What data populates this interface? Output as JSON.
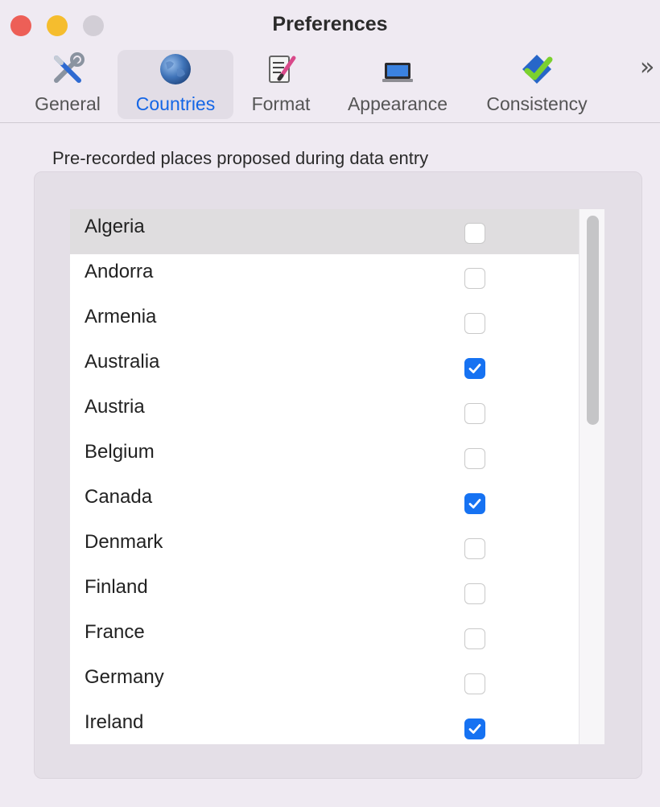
{
  "window": {
    "title": "Preferences"
  },
  "toolbar": {
    "tabs": [
      {
        "label": "General",
        "icon": "wrench-screwdriver-icon",
        "selected": false
      },
      {
        "label": "Countries",
        "icon": "globe-icon",
        "selected": true
      },
      {
        "label": "Format",
        "icon": "notepad-pencil-icon",
        "selected": false
      },
      {
        "label": "Appearance",
        "icon": "laptop-icon",
        "selected": false
      },
      {
        "label": "Consistency",
        "icon": "checkmark-diamond-icon",
        "selected": false
      }
    ],
    "overflow_label": "»"
  },
  "countries": {
    "caption": "Pre-recorded places proposed during data entry",
    "items": [
      {
        "name": "Algeria",
        "checked": false
      },
      {
        "name": "Andorra",
        "checked": false
      },
      {
        "name": "Armenia",
        "checked": false
      },
      {
        "name": "Australia",
        "checked": true
      },
      {
        "name": "Austria",
        "checked": false
      },
      {
        "name": "Belgium",
        "checked": false
      },
      {
        "name": "Canada",
        "checked": true
      },
      {
        "name": "Denmark",
        "checked": false
      },
      {
        "name": "Finland",
        "checked": false
      },
      {
        "name": "France",
        "checked": false
      },
      {
        "name": "Germany",
        "checked": false
      },
      {
        "name": "Ireland",
        "checked": true
      }
    ]
  },
  "colors": {
    "accent": "#1672f2",
    "selected_tab_text": "#1466e6"
  }
}
